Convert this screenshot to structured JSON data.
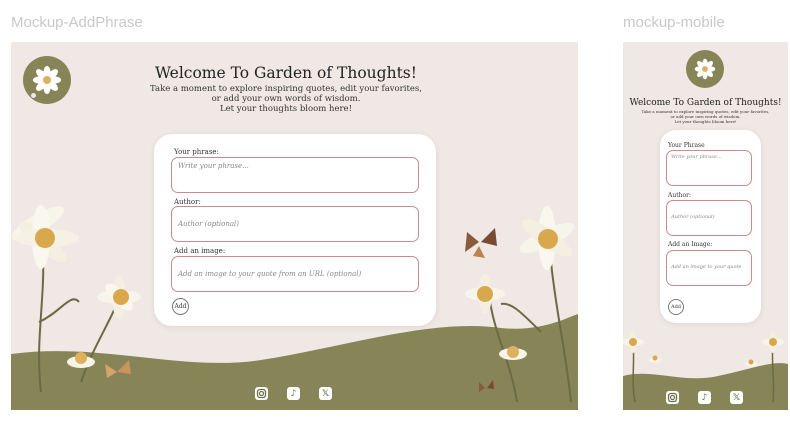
{
  "frames": {
    "desktop_label": "Mockup-AddPhrase",
    "mobile_label": "mockup-mobile"
  },
  "header": {
    "title": "Welcome To Garden of Thoughts!",
    "line1": "Take a moment to explore inspiring quotes, edit your favorites,",
    "line2": "or add your own words of wisdom.",
    "line3": "Let your thoughts bloom here!"
  },
  "form": {
    "phrase_label": "Your phrase:",
    "phrase_placeholder": "Write your phrase...",
    "author_label": "Author:",
    "author_placeholder": "Author (optional)",
    "image_label": "Add an image:",
    "image_placeholder": "Add an image to your quote from an URL (optional)",
    "add_button": "Add"
  },
  "mobile_form": {
    "phrase_label": "Your Phrase",
    "phrase_placeholder": "Write your phrase...",
    "author_label": "Author:",
    "author_placeholder": "Author (optional)",
    "image_label": "Add an Image:",
    "image_placeholder": "Add an image to your quote",
    "add_button": "Add"
  },
  "social_icons": [
    "instagram-icon",
    "tiktok-icon",
    "x-icon"
  ],
  "colors": {
    "background": "#efe8e4",
    "olive": "#878457",
    "field_border": "#c98d8d"
  }
}
